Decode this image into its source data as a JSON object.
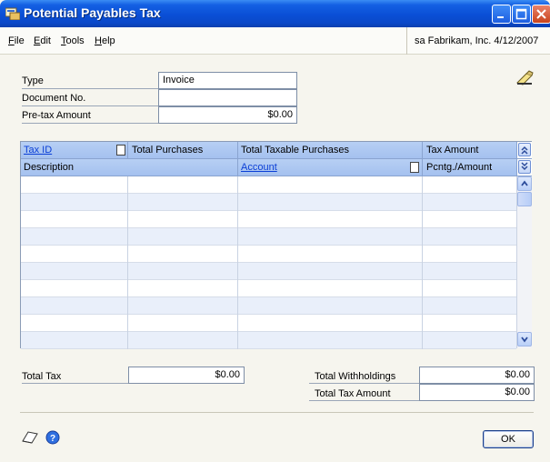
{
  "window": {
    "title": "Potential Payables Tax"
  },
  "menu": {
    "items": [
      {
        "key": "F",
        "rest": "ile"
      },
      {
        "key": "E",
        "rest": "dit"
      },
      {
        "key": "T",
        "rest": "ools"
      },
      {
        "key": "H",
        "rest": "elp"
      }
    ],
    "company": "sa  Fabrikam, Inc.  4/12/2007"
  },
  "header": {
    "type_label": "Type",
    "type_value": "Invoice",
    "document_label": "Document No.",
    "document_value": "",
    "pretax_label": "Pre-tax Amount",
    "pretax_value": "$0.00"
  },
  "grid": {
    "row1": {
      "tax_id": "Tax ID",
      "total_purchases": "Total Purchases",
      "total_taxable": "Total Taxable Purchases",
      "tax_amount": "Tax Amount"
    },
    "row2": {
      "description": "Description",
      "account": "Account",
      "pcntg": "Pcntg./Amount"
    },
    "row_count": 10
  },
  "totals": {
    "total_tax_label": "Total Tax",
    "total_tax_value": "$0.00",
    "withholdings_label": "Total Withholdings",
    "withholdings_value": "$0.00",
    "tax_amount_label": "Total Tax Amount",
    "tax_amount_value": "$0.00"
  },
  "buttons": {
    "ok": "OK"
  }
}
